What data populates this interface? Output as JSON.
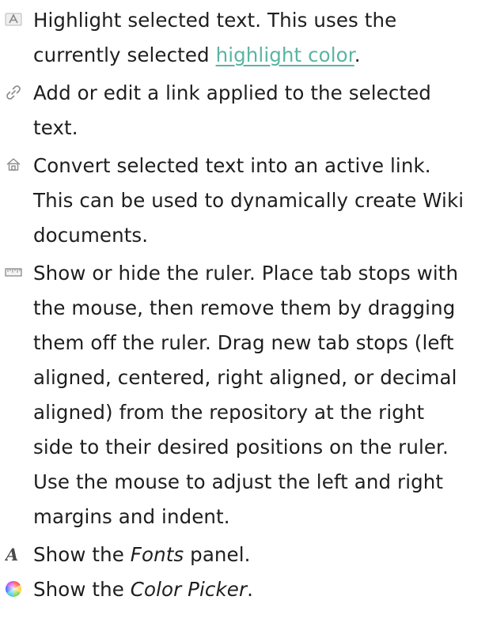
{
  "items": [
    {
      "icon": "highlight-icon",
      "lines": [
        {
          "parts": [
            "Highlight selected text. This uses the"
          ]
        },
        {
          "before": "currently selected ",
          "link": "highlight color",
          "after": "."
        }
      ]
    },
    {
      "icon": "link-icon",
      "lines": [
        "Add or edit a link applied to the selected",
        "text."
      ]
    },
    {
      "icon": "active-link-icon",
      "lines": [
        "Convert selected text into an active link.",
        "This can be used to dynamically create Wiki",
        "documents."
      ]
    },
    {
      "icon": "ruler-icon",
      "lines": [
        "Show or hide the ruler. Place tab stops with",
        "the mouse, then remove them by dragging",
        "them off the ruler. Drag new tab stops (left",
        "aligned, centered, right aligned, or decimal",
        "aligned) from the repository at the right",
        "side to their desired positions on the ruler.",
        "Use the mouse to adjust the left and right",
        "margins and indent."
      ]
    },
    {
      "icon": "fonts-icon",
      "before": "Show the ",
      "emphasis": "Fonts",
      "after": " panel."
    },
    {
      "icon": "color-picker-icon",
      "before": "Show the ",
      "emphasis": "Color Picker",
      "after": "."
    }
  ],
  "colors": {
    "link": "#5bb4a2",
    "text": "#1e1e1e",
    "icon": "#8a8a8a"
  }
}
